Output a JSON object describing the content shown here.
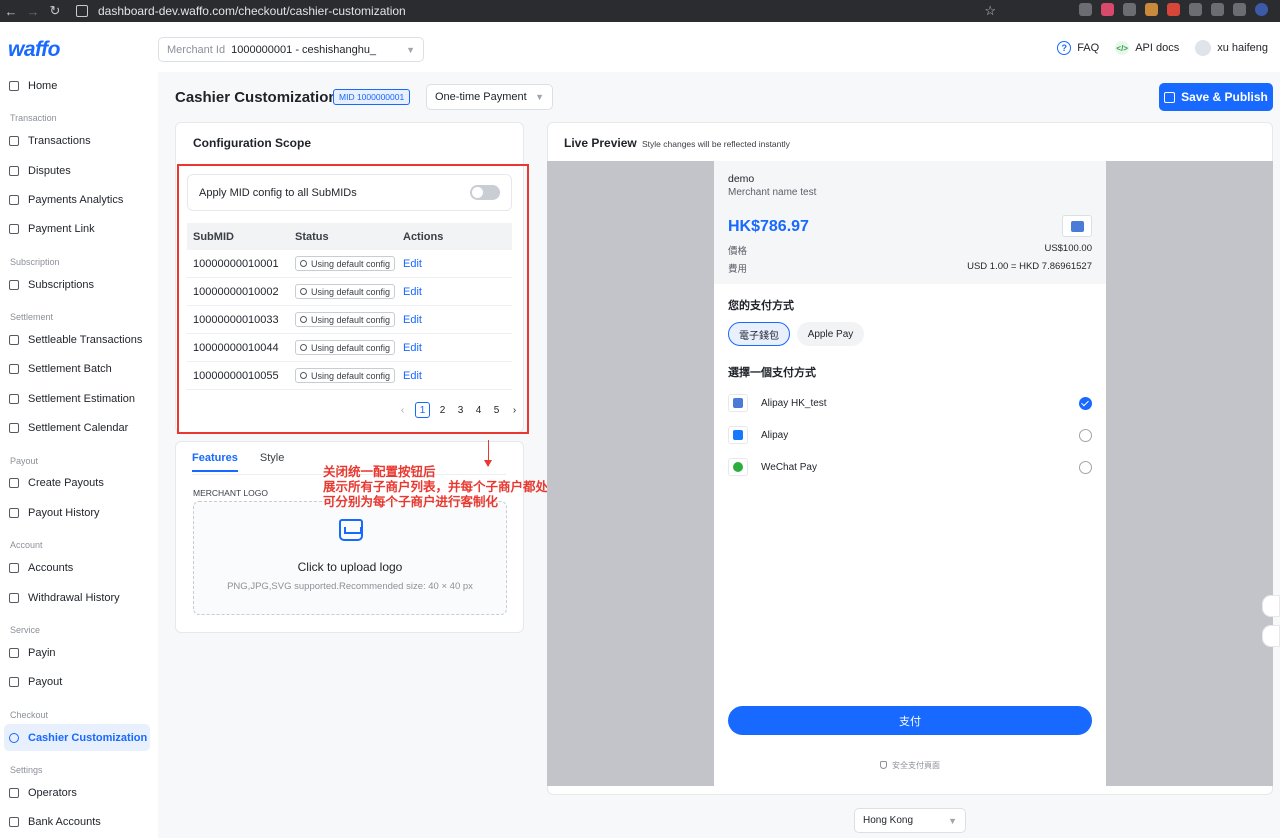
{
  "browser": {
    "url": "dashboard-dev.waffo.com/checkout/cashier-customization"
  },
  "header": {
    "logo": "waffo",
    "merchant_label": "Merchant Id",
    "merchant_value": "1000000001 - ceshishanghu_",
    "faq": "FAQ",
    "api_docs": "API docs",
    "user": "xu haifeng"
  },
  "sidebar": {
    "sections": {
      "transaction": "Transaction",
      "subscription": "Subscription",
      "settlement": "Settlement",
      "payout": "Payout",
      "account": "Account",
      "service": "Service",
      "checkout": "Checkout",
      "settings": "Settings"
    },
    "items": {
      "home": "Home",
      "transactions": "Transactions",
      "disputes": "Disputes",
      "payments_analytics": "Payments Analytics",
      "payment_link": "Payment Link",
      "subscriptions": "Subscriptions",
      "settleable_transactions": "Settleable Transactions",
      "settlement_batch": "Settlement Batch",
      "settlement_estimation": "Settlement Estimation",
      "settlement_calendar": "Settlement Calendar",
      "create_payouts": "Create Payouts",
      "payout_history": "Payout History",
      "accounts": "Accounts",
      "withdrawal_history": "Withdrawal History",
      "payin": "Payin",
      "payout": "Payout",
      "cashier_customization": "Cashier Customization",
      "operators": "Operators",
      "bank_accounts": "Bank Accounts"
    }
  },
  "page": {
    "title": "Cashier Customization",
    "mid_badge": "MID 1000000001",
    "payment_type": "One-time Payment",
    "save_button": "Save & Publish"
  },
  "config": {
    "title": "Configuration Scope",
    "toggle_label": "Apply MID config to all SubMIDs",
    "toggle_on": false,
    "columns": [
      "SubMID",
      "Status",
      "Actions"
    ],
    "rows": [
      {
        "submid": "10000000010001",
        "status": "Using default config",
        "action": "Edit"
      },
      {
        "submid": "10000000010002",
        "status": "Using default config",
        "action": "Edit"
      },
      {
        "submid": "10000000010033",
        "status": "Using default config",
        "action": "Edit"
      },
      {
        "submid": "10000000010044",
        "status": "Using default config",
        "action": "Edit"
      },
      {
        "submid": "10000000010055",
        "status": "Using default config",
        "action": "Edit"
      }
    ],
    "pages": [
      "1",
      "2",
      "3",
      "4",
      "5"
    ],
    "current_page": "1"
  },
  "features": {
    "tab_features": "Features",
    "tab_style": "Style",
    "logo_label": "MERCHANT LOGO",
    "upload_title": "Click to upload logo",
    "upload_hint": "PNG,JPG,SVG supported.Recommended size: 40 × 40 px"
  },
  "annotation": {
    "line1": "关闭统一配置按钮后",
    "line2": "展示所有子商户列表，并每个子商户都处于 Edit 状态，",
    "line3": "可分别为每个子商户进行客制化"
  },
  "preview": {
    "title": "Live Preview",
    "subtitle": "Style changes will be reflected instantly",
    "demo": "demo",
    "merchant_name": "Merchant name test",
    "amount": "HK$786.97",
    "price_label": "價格",
    "price_value": "US$100.00",
    "fee_label": "費用",
    "fee_value": "USD 1.00 = HKD 7.86961527",
    "method_heading": "您的支付方式",
    "tab_wallet": "電子錢包",
    "tab_apple": "Apple Pay",
    "choose_heading": "選擇一個支付方式",
    "methods": [
      {
        "name": "Alipay HK_test",
        "selected": true
      },
      {
        "name": "Alipay",
        "selected": false
      },
      {
        "name": "WeChat Pay",
        "selected": false
      }
    ],
    "pay_button": "支付",
    "secure_text": "安全支付頁面"
  },
  "region": "Hong Kong",
  "colors": {
    "brand": "#1769ff",
    "annotation": "#e8382f"
  }
}
